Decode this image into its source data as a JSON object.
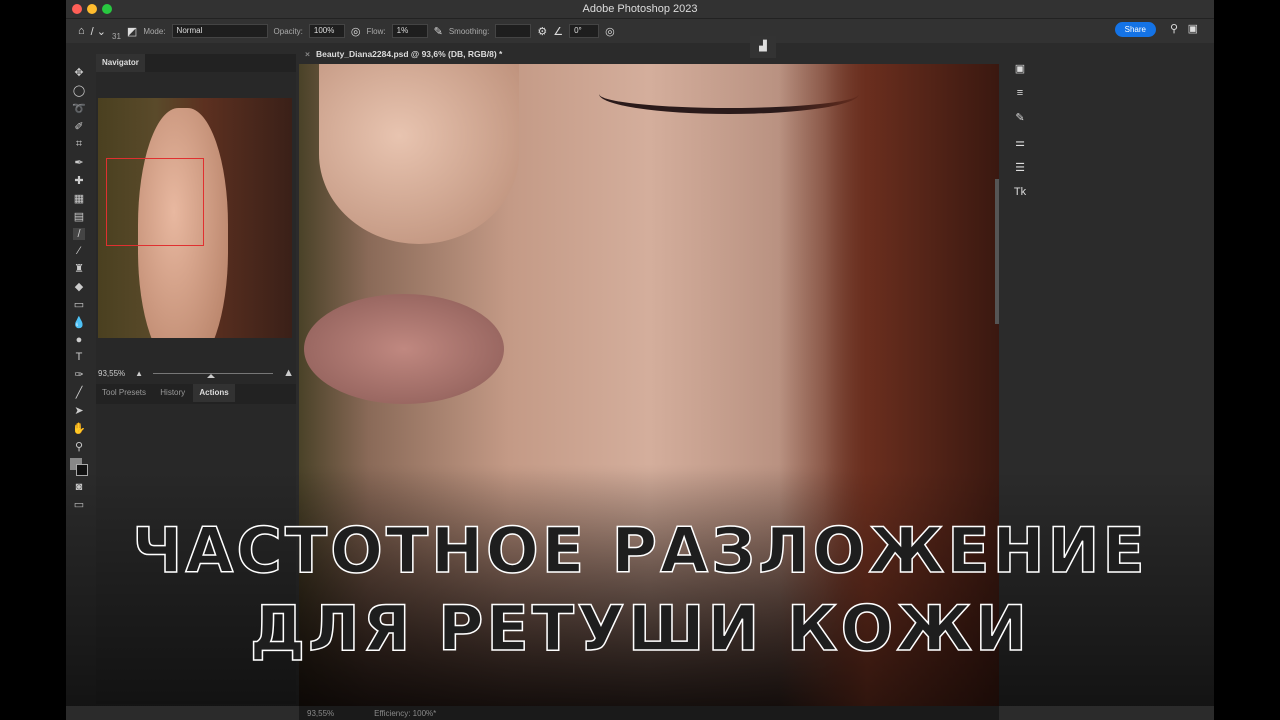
{
  "window": {
    "title": "Adobe Photoshop 2023"
  },
  "options": {
    "brush_size": "31",
    "mode_label": "Mode:",
    "mode_value": "Normal",
    "opacity_label": "Opacity:",
    "opacity_value": "100%",
    "flow_label": "Flow:",
    "flow_value": "1%",
    "smoothing_label": "Smoothing:",
    "smoothing_value": "",
    "angle_value": "0°",
    "share_label": "Share"
  },
  "document": {
    "tab_title": "Beauty_Diana2284.psd @ 93,6% (DB, RGB/8) *"
  },
  "navigator": {
    "tab": "Navigator",
    "zoom": "93,55%"
  },
  "panel_tabs": [
    "Tool Presets",
    "History",
    "Actions"
  ],
  "status": {
    "zoom": "93,55%",
    "info": "Efficiency: 100%*"
  },
  "headline": {
    "line1": "ЧАСТОТНОЕ РАЗЛОЖЕНИЕ",
    "line2": "ДЛЯ РЕТУШИ КОЖИ"
  },
  "colors": {
    "accent": "#1473e6"
  }
}
